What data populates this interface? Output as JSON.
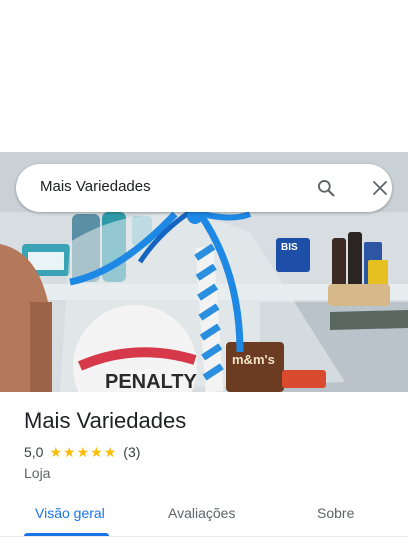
{
  "search": {
    "query": "Mais Variedades"
  },
  "place": {
    "title": "Mais Variedades",
    "rating": "5,0",
    "review_count": "(3)",
    "category": "Loja",
    "stars": 5
  },
  "tabs": [
    {
      "label": "Visão geral",
      "active": true
    },
    {
      "label": "Avaliações",
      "active": false
    },
    {
      "label": "Sobre",
      "active": false
    }
  ],
  "colors": {
    "accent": "#1a73e8",
    "star": "#fbbc04",
    "ribbon": "#1e88e5"
  },
  "photo": {
    "ball_brand_text": "PENALTY"
  }
}
